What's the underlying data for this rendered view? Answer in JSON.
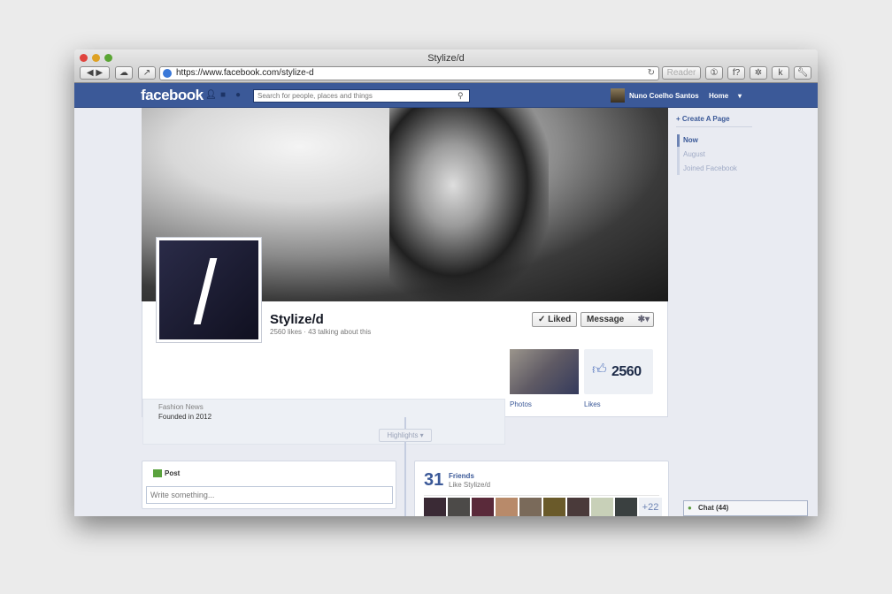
{
  "window": {
    "title": "Stylize/d",
    "url": "https://www.facebook.com/stylize-d",
    "reader": "Reader"
  },
  "fb": {
    "logo": "facebook",
    "search_placeholder": "Search for people, places and things",
    "user": "Nuno Coelho Santos",
    "home": "Home"
  },
  "page": {
    "name": "Stylize/d",
    "stats": "2560 likes · 43 talking about this",
    "liked": "✓ Liked",
    "message": "Message",
    "category": "Fashion News",
    "founded": "Founded in 2012",
    "photos": "Photos",
    "likes_label": "Likes",
    "likes_count": "2560"
  },
  "timeline": {
    "create": "+ Create A Page",
    "items": [
      "Now",
      "August",
      "Joined Facebook"
    ],
    "highlights": "Highlights ▾"
  },
  "post": {
    "label": "Post",
    "placeholder": "Write something..."
  },
  "friends": {
    "count": "31",
    "label": "Friends",
    "sub": "Like Stylize/d",
    "more": "+22"
  },
  "chat": {
    "label": "Chat (44)"
  }
}
